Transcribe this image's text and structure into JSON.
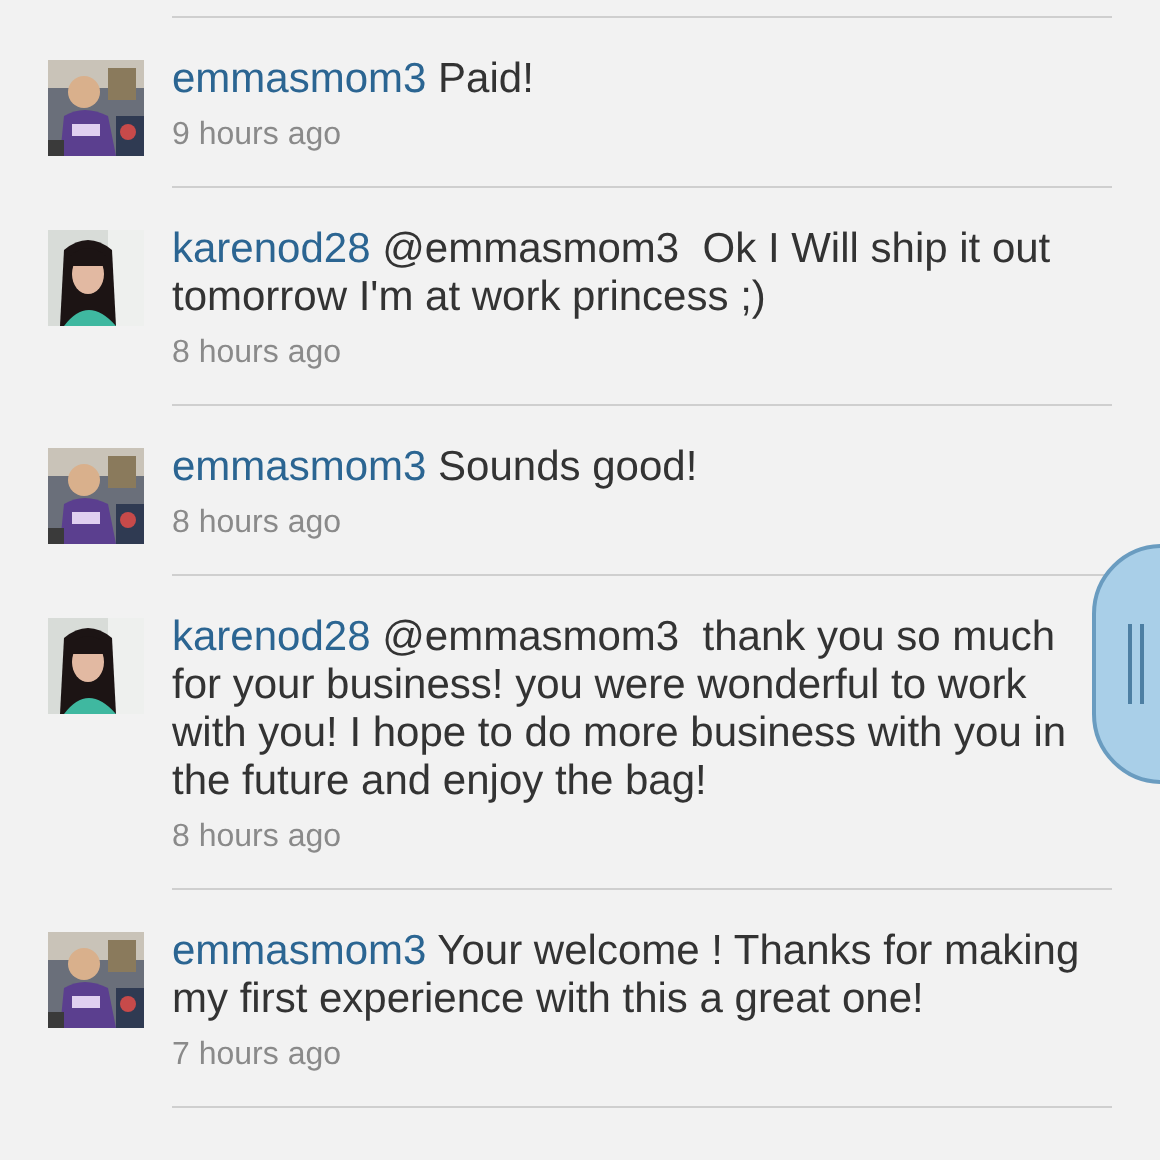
{
  "comments": [
    {
      "user": "emmasmom3",
      "text": "Paid!",
      "time": "9 hours ago"
    },
    {
      "user": "karenod28",
      "text": "@emmasmom3  Ok I Will ship it out tomorrow I'm at work princess ;)",
      "time": "8 hours ago"
    },
    {
      "user": "emmasmom3",
      "text": "Sounds good!",
      "time": "8 hours ago"
    },
    {
      "user": "karenod28",
      "text": "@emmasmom3  thank you so much for your business! you were wonderful to work with you! I hope to do more business with you in the future and enjoy the bag!",
      "time": "8 hours ago"
    },
    {
      "user": "emmasmom3",
      "text": "Your welcome ! Thanks for making my first experience with this a great one!",
      "time": "7 hours ago"
    }
  ]
}
